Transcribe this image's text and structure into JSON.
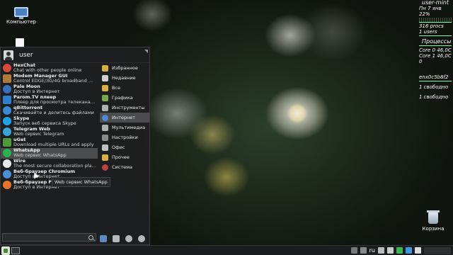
{
  "desktop": {
    "icons": [
      {
        "label": "Компьютер",
        "icon": "computer-icon"
      },
      {
        "label": "Корзина",
        "icon": "trash-icon"
      }
    ]
  },
  "conky": {
    "hostname": "user-mint",
    "date": "Пн   7 янв",
    "cpu": "22%",
    "procs": "316 procs",
    "users": "1 users",
    "processes_header": "Процессы",
    "core0": "Core 0  46,0C",
    "core1": "Core 1  46,0C",
    "zero": "0",
    "net_iface": "enx0c5b8f2",
    "free1": "1 свободно",
    "free2": "1 свободно"
  },
  "menu": {
    "username": "user",
    "apps": [
      {
        "name": "HexChat",
        "desc": "Chat with other people online",
        "color": "#d64a3a"
      },
      {
        "name": "Modem Manager GUI",
        "desc": "Control EDGE/3G/4G broadband modem",
        "color": "#b07a3a"
      },
      {
        "name": "Pale Moon",
        "desc": "Доступ в Интернет",
        "color": "#3a6fbf"
      },
      {
        "name": "Parom.TV плеер",
        "desc": "Плеер для просмотра телеканалов",
        "color": "#2d7fd0"
      },
      {
        "name": "qBittorrent",
        "desc": "Скачивайте и делитесь файлами",
        "color": "#3a8ad8"
      },
      {
        "name": "Skype",
        "desc": "Запуск веб сервиса Skype",
        "color": "#1fa3e6"
      },
      {
        "name": "Telegram Web",
        "desc": "Web сервис Telegram",
        "color": "#39a3dc"
      },
      {
        "name": "uGet",
        "desc": "Download multiple URLs and apply",
        "color": "#4c9a3a"
      },
      {
        "name": "WhatsApp",
        "desc": "Web сервис WhatsApp",
        "color": "#2bb24c"
      },
      {
        "name": "Wire",
        "desc": "The most secure collaboration platform",
        "color": "#e8e8e8"
      },
      {
        "name": "Веб-браузер Chromium",
        "desc": "Доступ в Интернет",
        "color": "#4b8fd9"
      },
      {
        "name": "Веб-браузер Firefox",
        "desc": "Доступ в Интернет",
        "color": "#e8732a"
      }
    ],
    "categories": [
      {
        "label": "Избранное",
        "color": "#d9b040"
      },
      {
        "label": "Недавние",
        "color": "#cfcfcf"
      },
      {
        "label": "Все",
        "color": "#d9b040"
      },
      {
        "label": "Графика",
        "color": "#7aa84a"
      },
      {
        "label": "Инструменты",
        "color": "#b0b0b0"
      },
      {
        "label": "Интернет",
        "color": "#4a8ad8"
      },
      {
        "label": "Мультимедиа",
        "color": "#b0b0b0"
      },
      {
        "label": "Настройки",
        "color": "#8a8a8a"
      },
      {
        "label": "Офис",
        "color": "#c0c0c0"
      },
      {
        "label": "Прочее",
        "color": "#d9b040"
      },
      {
        "label": "Система",
        "color": "#c04040"
      }
    ],
    "search_placeholder": "",
    "tooltip": "Web сервис WhatsApp"
  },
  "taskbar": {
    "layout": "ru"
  }
}
